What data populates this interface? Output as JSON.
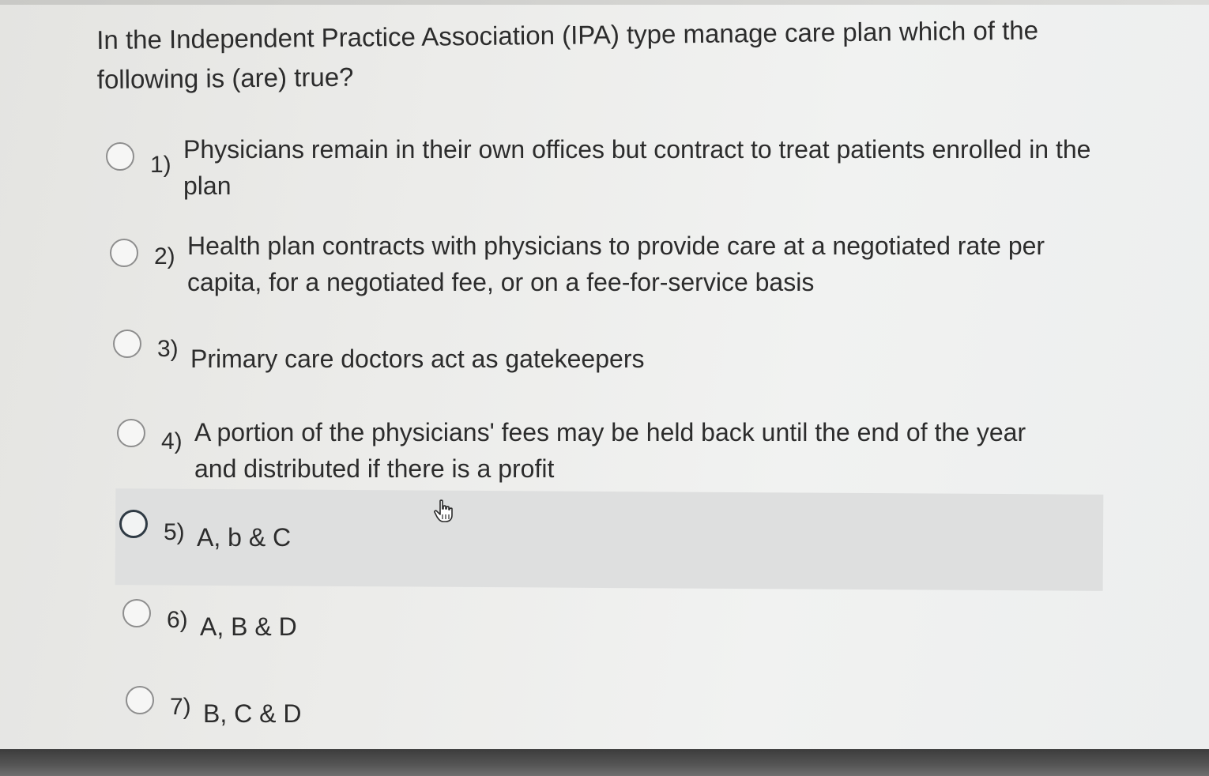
{
  "question": {
    "text": "In the Independent Practice Association (IPA) type manage care plan which of the following is (are) true?"
  },
  "options": [
    {
      "number": "1)",
      "text": "Physicians remain in their own offices but contract to treat patients enrolled in the plan"
    },
    {
      "number": "2)",
      "text": "Health plan contracts with physicians to provide care at a negotiated rate per capita, for a negotiated fee, or on a fee-for-service basis"
    },
    {
      "number": "3)",
      "text": "Primary care doctors act as gatekeepers"
    },
    {
      "number": "4)",
      "text": "A portion of the physicians' fees may be held back until the end of the year and distributed if there is a profit"
    },
    {
      "number": "5)",
      "text": "A, b & C"
    },
    {
      "number": "6)",
      "text": "A, B & D"
    },
    {
      "number": "7)",
      "text": "B, C & D"
    }
  ],
  "state": {
    "hovered_option": "5)"
  },
  "icons": {
    "cursor": "hand-pointer-icon"
  }
}
